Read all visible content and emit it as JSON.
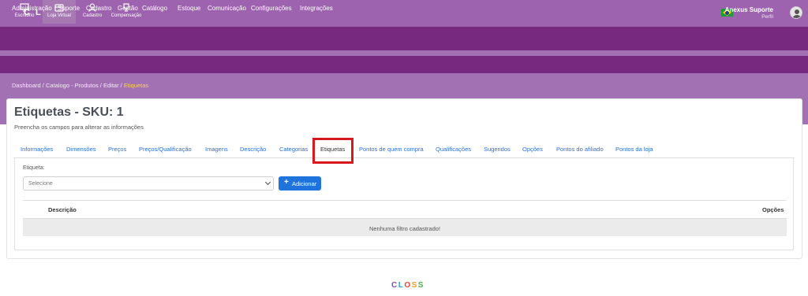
{
  "brand": {
    "logo_text": "CLOSS"
  },
  "user": {
    "name": "Anexus Suporte",
    "sub": "Perfil"
  },
  "modules": [
    {
      "label": "Escritório",
      "icon": "monitor-icon"
    },
    {
      "label": "Loja Virtual",
      "icon": "store-icon"
    },
    {
      "label": "Cadastro",
      "icon": "user-icon"
    },
    {
      "label": "Compensação",
      "icon": "trophy-icon"
    }
  ],
  "menu": [
    "Administração",
    "Suporte",
    "Cadastro",
    "Gestão",
    "Catálogo",
    "Estoque",
    "Comunicação",
    "Configurações",
    "Integrações"
  ],
  "breadcrumb": {
    "items": [
      "Dashboard",
      "Catalogo - Produtos",
      "Editar"
    ],
    "current": "Etiquetas",
    "separator": "/"
  },
  "page": {
    "title": "Etiquetas - SKU: 1",
    "subtitle": "Preencha os campos para alterar as informações"
  },
  "tabs": [
    "Informações",
    "Dimensões",
    "Preços",
    "Preços/Qualificação",
    "Imagens",
    "Descrição",
    "Categorias",
    "Etiquetas",
    "Pontos de quem compra",
    "Qualificações",
    "Sugeridos",
    "Opções",
    "Pontos do afiliado",
    "Pontos da loja"
  ],
  "active_tab": "Etiquetas",
  "form": {
    "label": "Etiqueta:",
    "select_value": "Selecione",
    "add_button": "Adicionar"
  },
  "table": {
    "col_description": "Descrição",
    "col_options": "Opções",
    "empty_message": "Nenhuma filtro cadastrado!"
  },
  "colors": {
    "accent": "#76297f",
    "topbar": "#9d63ae",
    "button": "#1e74dc",
    "highlight": "#d8181f",
    "crumb_current": "#ffd24a"
  }
}
